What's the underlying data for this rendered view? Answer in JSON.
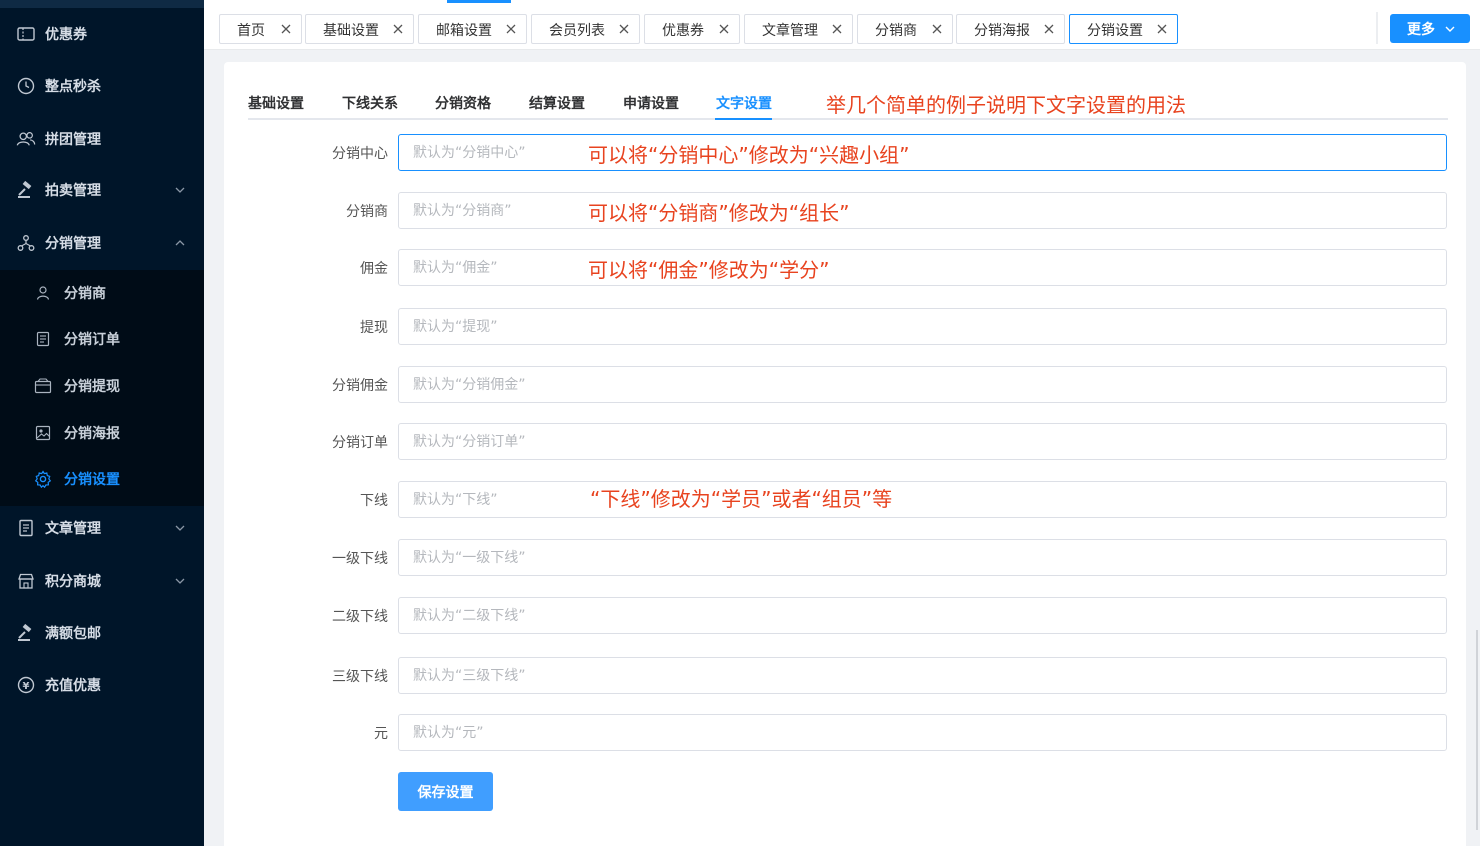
{
  "sidebar": {
    "items": [
      {
        "label": "优惠券",
        "icon": "coupon-icon"
      },
      {
        "label": "整点秒杀",
        "icon": "flash-sale-icon"
      },
      {
        "label": "拼团管理",
        "icon": "group-buy-icon"
      },
      {
        "label": "拍卖管理",
        "icon": "gavel-icon"
      },
      {
        "label": "分销管理",
        "icon": "distribution-icon"
      },
      {
        "label": "文章管理",
        "icon": "article-icon"
      },
      {
        "label": "积分商城",
        "icon": "store-icon"
      },
      {
        "label": "满额包邮",
        "icon": "free-shipping-icon"
      },
      {
        "label": "充值优惠",
        "icon": "yen-icon"
      }
    ],
    "sub_items": [
      {
        "label": "分销商",
        "icon": "user-icon"
      },
      {
        "label": "分销订单",
        "icon": "order-icon"
      },
      {
        "label": "分销提现",
        "icon": "wallet-icon"
      },
      {
        "label": "分销海报",
        "icon": "poster-icon"
      },
      {
        "label": "分销设置",
        "icon": "gear-icon"
      }
    ],
    "active_color": "#1890ff"
  },
  "tabs": [
    {
      "label": "首页"
    },
    {
      "label": "基础设置"
    },
    {
      "label": "邮箱设置"
    },
    {
      "label": "会员列表"
    },
    {
      "label": "优惠券"
    },
    {
      "label": "文章管理"
    },
    {
      "label": "分销商"
    },
    {
      "label": "分销海报"
    },
    {
      "label": "分销设置"
    }
  ],
  "more_button": "更多",
  "sub_tabs": [
    {
      "label": "基础设置"
    },
    {
      "label": "下线关系"
    },
    {
      "label": "分销资格"
    },
    {
      "label": "结算设置"
    },
    {
      "label": "申请设置"
    },
    {
      "label": "文字设置"
    }
  ],
  "note_title": "举几个简单的例子说明下文字设置的用法",
  "form": {
    "fields": [
      {
        "label": "分销中心",
        "placeholder": "默认为“分销中心”",
        "value": "",
        "annotation": "可以将“分销中心”修改为“兴趣小组”"
      },
      {
        "label": "分销商",
        "placeholder": "默认为“分销商”",
        "value": "",
        "annotation": "可以将“分销商”修改为“组长”"
      },
      {
        "label": "佣金",
        "placeholder": "默认为“佣金”",
        "value": "",
        "annotation": "可以将“佣金”修改为“学分”"
      },
      {
        "label": "提现",
        "placeholder": "默认为“提现”",
        "value": ""
      },
      {
        "label": "分销佣金",
        "placeholder": "默认为“分销佣金”",
        "value": ""
      },
      {
        "label": "分销订单",
        "placeholder": "默认为“分销订单”",
        "value": ""
      },
      {
        "label": "下线",
        "placeholder": "默认为“下线”",
        "value": "",
        "annotation": "“下线”修改为“学员”或者“组员”等"
      },
      {
        "label": "一级下线",
        "placeholder": "默认为“一级下线”",
        "value": ""
      },
      {
        "label": "二级下线",
        "placeholder": "默认为“二级下线”",
        "value": ""
      },
      {
        "label": "三级下线",
        "placeholder": "默认为“三级下线”",
        "value": ""
      },
      {
        "label": "元",
        "placeholder": "默认为“元”",
        "value": ""
      }
    ],
    "save_label": "保存设置"
  },
  "colors": {
    "primary": "#1890ff",
    "annotation": "#e8431f",
    "sidebar_bg": "#001529"
  }
}
